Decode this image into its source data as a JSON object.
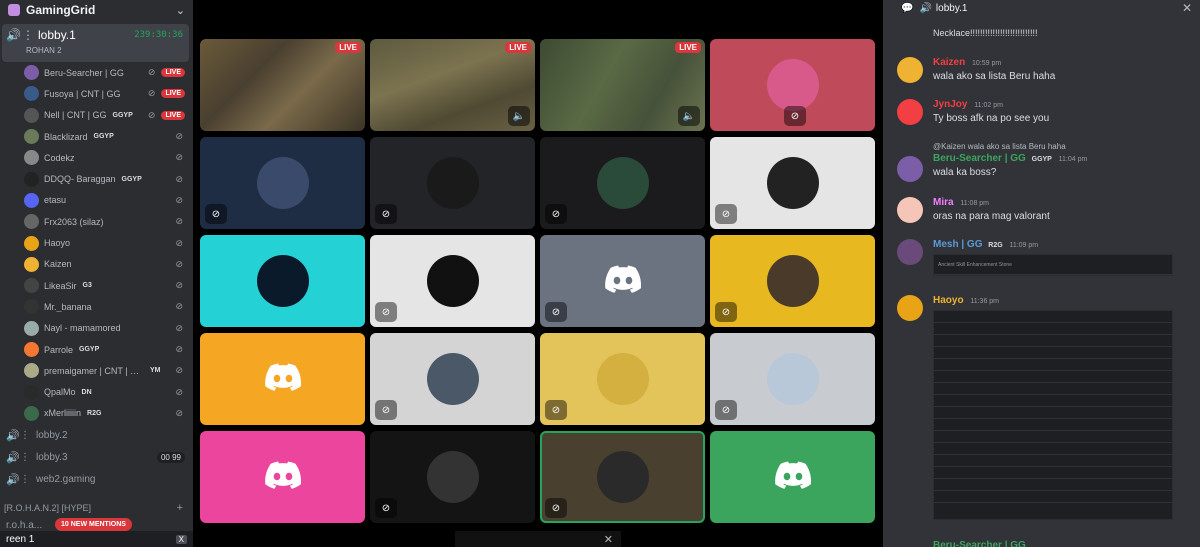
{
  "server": {
    "name": "GamingGrid"
  },
  "active_channel": {
    "name": "lobby.1",
    "timer": "239:30:36",
    "subtitle": "ROHAN 2"
  },
  "voice_users": [
    {
      "name": "Beru-Searcher | GG",
      "tag": "",
      "live": true,
      "av": "#7b5ea7"
    },
    {
      "name": "Fusoya | CNT | GG",
      "tag": "",
      "live": true,
      "av": "#3a5a8a"
    },
    {
      "name": "Nell | CNT | GG",
      "tag": "GGYP",
      "live": true,
      "av": "#555"
    },
    {
      "name": "Blacklizard",
      "tag": "GGYP",
      "live": false,
      "av": "#6a7a5a"
    },
    {
      "name": "Codekz",
      "tag": "",
      "live": false,
      "av": "#888"
    },
    {
      "name": "DDQQ- Baraggan",
      "tag": "GGYP",
      "live": false,
      "av": "#222"
    },
    {
      "name": "etasu",
      "tag": "",
      "live": false,
      "av": "#5865f2"
    },
    {
      "name": "Frx2063 (silaz)",
      "tag": "",
      "live": false,
      "av": "#666"
    },
    {
      "name": "Haoyo",
      "tag": "",
      "live": false,
      "av": "#e8a317"
    },
    {
      "name": "Kaizen",
      "tag": "",
      "live": false,
      "av": "#f0b232"
    },
    {
      "name": "LikeaSir",
      "tag": "G3",
      "live": false,
      "av": "#444"
    },
    {
      "name": "Mr._banana",
      "tag": "",
      "live": false,
      "av": "#333"
    },
    {
      "name": "Nayl - mamamored",
      "tag": "",
      "live": false,
      "av": "#9aa"
    },
    {
      "name": "Parrole",
      "tag": "GGYP",
      "live": false,
      "av": "#f57731"
    },
    {
      "name": "premaigamer | CNT | GG",
      "tag": "YM",
      "live": false,
      "av": "#aa8"
    },
    {
      "name": "QpalMo",
      "tag": "DN",
      "live": false,
      "av": "#2a2a2a"
    },
    {
      "name": "xMerliiiiin",
      "tag": "R2G",
      "live": false,
      "av": "#3a6a4a"
    }
  ],
  "channels": [
    {
      "name": "lobby.2",
      "count": ""
    },
    {
      "name": "lobby.3",
      "count": "00 99"
    },
    {
      "name": "web2.gaming",
      "count": ""
    }
  ],
  "category": {
    "name": "[R.O.H.A.N.2] [HYPE]"
  },
  "mentions": {
    "label": "10 NEW MENTIONS",
    "channel": "r.o.h.a..."
  },
  "screen_bar": {
    "label": "reen 1",
    "close": "X"
  },
  "grid": {
    "live_label": "LIVE",
    "tiles": [
      {
        "kind": "stream",
        "bg": "stream",
        "live": true
      },
      {
        "kind": "stream",
        "bg": "stream2",
        "live": true
      },
      {
        "kind": "stream",
        "bg": "stream3",
        "live": true
      },
      {
        "kind": "avatar",
        "bg": "#bf4a5a",
        "av": "#d85a8a"
      },
      {
        "kind": "avatar",
        "bg": "#1e2c44",
        "av": "#3a4a6a"
      },
      {
        "kind": "avatar",
        "bg": "#232428",
        "av": "#1a1a1a"
      },
      {
        "kind": "avatar",
        "bg": "#1b1b1d",
        "av": "#2a4a3a"
      },
      {
        "kind": "avatar",
        "bg": "#e5e5e5",
        "av": "#222"
      },
      {
        "kind": "avatar",
        "bg": "#24d1d5",
        "av": "#0b1a2a"
      },
      {
        "kind": "avatar",
        "bg": "#e5e5e5",
        "av": "#111"
      },
      {
        "kind": "discord",
        "bg": "#6b7280"
      },
      {
        "kind": "avatar",
        "bg": "#e8b820",
        "av": "#4a3a2a"
      },
      {
        "kind": "discord",
        "bg": "#f5a623"
      },
      {
        "kind": "avatar",
        "bg": "#d4d4d4",
        "av": "#4a5868"
      },
      {
        "kind": "avatar",
        "bg": "#e3c45a",
        "av": "#d4b040"
      },
      {
        "kind": "avatar",
        "bg": "#c8ccd0",
        "av": "#b8c8d8"
      },
      {
        "kind": "discord",
        "bg": "#eb459e"
      },
      {
        "kind": "avatar",
        "bg": "#141414",
        "av": "#333"
      },
      {
        "kind": "avatar",
        "bg": "#4a4030",
        "av": "#2a2a2a"
      },
      {
        "kind": "discord",
        "bg": "#3ba55d"
      }
    ]
  },
  "chat": {
    "title": "lobby.1",
    "first_line": "Necklace!!!!!!!!!!!!!!!!!!!!!!!!!!!",
    "messages": [
      {
        "author": "Kaizen",
        "color": "#f23f43",
        "time": "10:59 pm",
        "text": "wala ako sa lista Beru haha",
        "av": "#f0b232",
        "tag": ""
      },
      {
        "author": "JynJoy",
        "color": "#f23f43",
        "time": "11:02 pm",
        "text": "Ty boss afk na po see you",
        "av": "#f23f43",
        "tag": ""
      },
      {
        "author": "Beru-Searcher | GG",
        "color": "#3ba55d",
        "time": "11:04 pm",
        "text": "wala ka boss?",
        "av": "#7b5ea7",
        "tag": "GGYP",
        "reply": "@Kaizen wala ako sa lista Beru haha"
      },
      {
        "author": "Mira",
        "color": "#f47fff",
        "time": "11:08 pm",
        "text": "oras na para mag valorant",
        "av": "#f5c6b8",
        "tag": ""
      },
      {
        "author": "Mesh | GG",
        "color": "#5b9bd5",
        "time": "11:09 pm",
        "text": "",
        "av": "#6a4a7a",
        "tag": "R2G"
      },
      {
        "author": "Haoyo",
        "color": "#f0b232",
        "time": "11:36 pm",
        "text": "",
        "av": "#e8a317",
        "tag": ""
      }
    ],
    "embed_row": "Ancient Skill Enhancement Stone",
    "last_author": "Beru-Searcher | GG"
  }
}
